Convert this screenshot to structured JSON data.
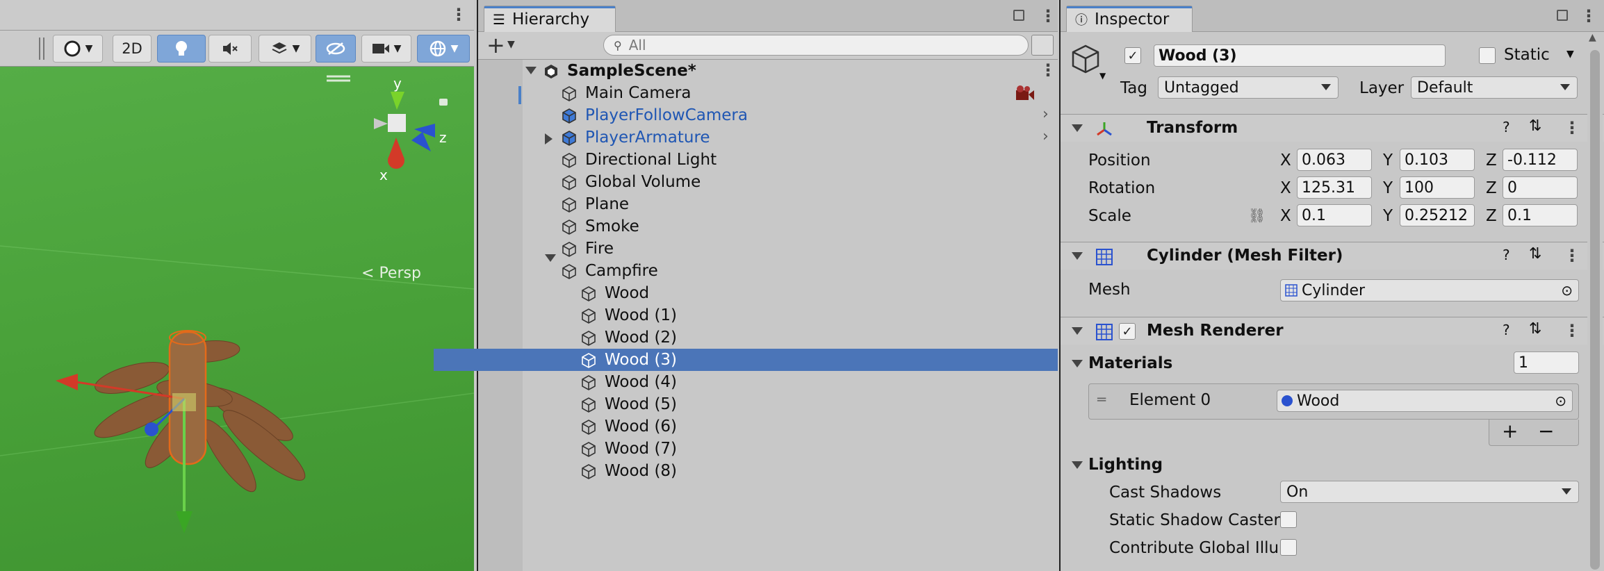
{
  "scene": {
    "toolbar": {
      "mode_2d": "2D"
    },
    "gizmo": {
      "axis_y": "y",
      "axis_z": "z",
      "axis_x": "x",
      "projection": "Persp"
    }
  },
  "hierarchy": {
    "tab_label": "Hierarchy",
    "search_placeholder": "All",
    "scene_name": "SampleScene*",
    "items": [
      {
        "label": "Main Camera",
        "color": "#101010"
      },
      {
        "label": "PlayerFollowCamera",
        "color": "#1f56b3"
      },
      {
        "label": "PlayerArmature",
        "color": "#1f56b3"
      },
      {
        "label": "Directional Light",
        "color": "#101010"
      },
      {
        "label": "Global Volume",
        "color": "#101010"
      },
      {
        "label": "Plane",
        "color": "#101010"
      },
      {
        "label": "Smoke",
        "color": "#101010"
      },
      {
        "label": "Fire",
        "color": "#101010"
      },
      {
        "label": "Campfire",
        "color": "#101010"
      }
    ],
    "children": [
      "Wood",
      "Wood (1)",
      "Wood (2)",
      "Wood (3)",
      "Wood (4)",
      "Wood (5)",
      "Wood (6)",
      "Wood (7)",
      "Wood (8)"
    ],
    "selected": "Wood (3)"
  },
  "inspector": {
    "tab_label": "Inspector",
    "object_name": "Wood (3)",
    "static_label": "Static",
    "tag_label": "Tag",
    "tag_value": "Untagged",
    "layer_label": "Layer",
    "layer_value": "Default",
    "transform": {
      "title": "Transform",
      "position_label": "Position",
      "rotation_label": "Rotation",
      "scale_label": "Scale",
      "x": "X",
      "y": "Y",
      "z": "Z",
      "position": [
        "0.063",
        "0.103",
        "-0.112"
      ],
      "rotation": [
        "125.31",
        "100",
        "0"
      ],
      "scale": [
        "0.1",
        "0.25212",
        "0.1"
      ]
    },
    "mesh_filter": {
      "title": "Cylinder (Mesh Filter)",
      "mesh_label": "Mesh",
      "mesh_value": "Cylinder"
    },
    "mesh_renderer": {
      "title": "Mesh Renderer",
      "materials_label": "Materials",
      "materials_count": "1",
      "element_label": "Element 0",
      "element_value": "Wood",
      "add_label": "+",
      "remove_label": "−",
      "lighting_label": "Lighting",
      "cast_shadows_label": "Cast Shadows",
      "cast_shadows_value": "On",
      "static_shadow_caster_label": "Static Shadow Caster",
      "contribute_gi_label": "Contribute Global Illur"
    }
  }
}
